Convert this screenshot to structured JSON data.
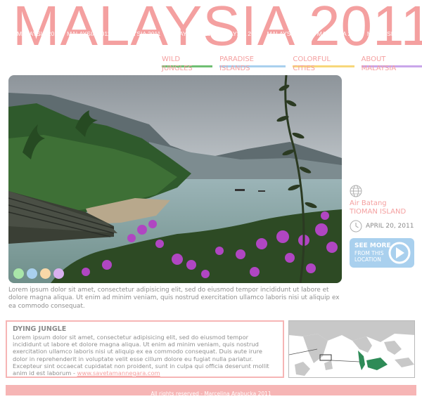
{
  "header": {
    "title": "MALAYSIA 2011",
    "strip_label": "MALAYSIA 2011",
    "strip_repeat": 8
  },
  "nav": {
    "items": [
      {
        "label": "WILD JUNGLES",
        "color": "#6fbf73"
      },
      {
        "label": "PARADISE ISLANDS",
        "color": "#a9d0ee"
      },
      {
        "label": "COLORFUL CITIES",
        "color": "#f7d77a"
      },
      {
        "label": "ABOUT MALAYSIA",
        "color": "#c9a6ea"
      }
    ]
  },
  "photo": {
    "dots": [
      "#a9e6a9",
      "#a9d0ee",
      "#f8d8a8",
      "#d9b0f0"
    ]
  },
  "intro": {
    "text": "Lorem ipsum dolor sit amet, consectetur adipisicing elit, sed do eiusmod tempor incididunt ut labore et dolore magna aliqua. Ut enim ad minim veniam, quis nostrud exercitation ullamco laboris nisi ut aliquip ex ea commodo consequat."
  },
  "location": {
    "line1": "Air Batang",
    "line2": "TIOMAN ISLAND",
    "date": "APRIL 20, 2011",
    "see_more_label": "SEE MORE",
    "see_more_sub": "FROM THIS LOCATION"
  },
  "jungle": {
    "heading": "DYING JUNGLE",
    "text": "Lorem ipsum dolor sit amet, consectetur adipisicing elit, sed do eiusmod tempor incididunt ut labore et dolore magna aliqua. Ut enim ad minim veniam, quis nostrud exercitation ullamco laboris nisi ut aliquip ex ea commodo consequat. Duis aute irure dolor in reprehenderit in voluptate velit esse cillum dolore eu fugiat nulla pariatur. Excepteur sint occaecat cupidatat non proident, sunt in culpa qui officia deserunt mollit anim id est laborum - ",
    "link": "www.savetamannegara.com"
  },
  "footer": {
    "text": "All rights reserved - Marcelina Arabucka 2011"
  },
  "colors": {
    "accent_pink": "#f4a0a0",
    "light_pink": "#f6b5b5",
    "text_gray": "#8a8a8a",
    "button_blue": "#a9d0ee",
    "map_highlight": "#2e8b57"
  }
}
